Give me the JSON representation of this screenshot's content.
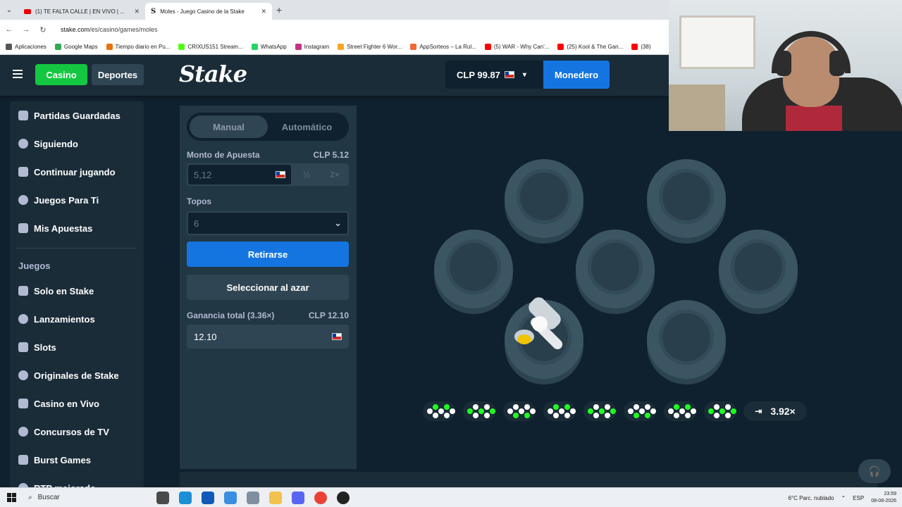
{
  "browser": {
    "tabs": [
      {
        "title": "(1) TE FALTA CALLE | EN VIVO | ...",
        "icon": "youtube-icon"
      },
      {
        "title": "Moles - Juego Casino de la Stake",
        "icon": "stake-icon"
      }
    ],
    "url_host": "stake.com",
    "url_path": "/es/casino/games/moles",
    "bookmarks": [
      {
        "label": "Aplicaciones",
        "color": "#555555"
      },
      {
        "label": "Google Maps",
        "color": "#34a853"
      },
      {
        "label": "Tiempo diario en Pu...",
        "color": "#e8710a"
      },
      {
        "label": "CRIXUS151 Stream...",
        "color": "#53fc18"
      },
      {
        "label": "WhatsApp",
        "color": "#25d366"
      },
      {
        "label": "Instagram",
        "color": "#c13584"
      },
      {
        "label": "Street Fighter 6 Wor...",
        "color": "#f5a623"
      },
      {
        "label": "AppSorteos – La Rul...",
        "color": "#f06a35"
      },
      {
        "label": "(5) WAR - Why Can'...",
        "color": "#ff0000"
      },
      {
        "label": "(25) Kool & The Gan...",
        "color": "#ff0000"
      },
      {
        "label": "(38)",
        "color": "#ff0000"
      }
    ]
  },
  "header": {
    "casino_label": "Casino",
    "sports_label": "Deportes",
    "logo": "Stake",
    "balance": "CLP 99.87",
    "wallet_label": "Monedero"
  },
  "sidebar": {
    "items": [
      {
        "label": "Partidas Guardadas",
        "icon": "bookmark-icon"
      },
      {
        "label": "Siguiendo",
        "icon": "heart-icon"
      },
      {
        "label": "Continuar jugando",
        "icon": "arrow-circle-icon"
      },
      {
        "label": "Juegos Para Ti",
        "icon": "gear-icon"
      },
      {
        "label": "Mis Apuestas",
        "icon": "list-icon"
      }
    ],
    "section_title": "Juegos",
    "game_items": [
      {
        "label": "Solo en Stake",
        "icon": "star-icon"
      },
      {
        "label": "Lanzamientos",
        "icon": "rocket-icon"
      },
      {
        "label": "Slots",
        "icon": "slot-machine-icon"
      },
      {
        "label": "Originales de Stake",
        "icon": "flame-icon"
      },
      {
        "label": "Casino en Vivo",
        "icon": "live-icon"
      },
      {
        "label": "Concursos de TV",
        "icon": "tv-icon"
      },
      {
        "label": "Burst Games",
        "icon": "burst-icon"
      },
      {
        "label": "RTP mejorado",
        "icon": "rtp-icon"
      }
    ]
  },
  "panel": {
    "tab_manual": "Manual",
    "tab_auto": "Automático",
    "bet_label": "Monto de Apuesta",
    "bet_value_label": "CLP 5.12",
    "bet_input": "5,12",
    "half_label": "½",
    "double_label": "2×",
    "moles_label": "Topos",
    "moles_value": "6",
    "cashout_label": "Retirarse",
    "random_label": "Seleccionar al azar",
    "profit_label": "Ganancia total (3.36×)",
    "profit_value_label": "CLP 12.10",
    "profit_value": "12.10"
  },
  "game": {
    "holes": 7,
    "revealed_mole": "hammer-icon",
    "next_multiplier": "3.92×"
  },
  "taskbar": {
    "search_label": "Buscar",
    "weather": "6°C  Parc. nublado",
    "lang": "ESP",
    "time": "23:59",
    "date": "08-08-2026"
  },
  "colors": {
    "bg": "#0f212e",
    "panel": "#213743",
    "accent_green": "#13c840",
    "accent_blue": "#1475e1",
    "mole_green": "#1fff20"
  }
}
